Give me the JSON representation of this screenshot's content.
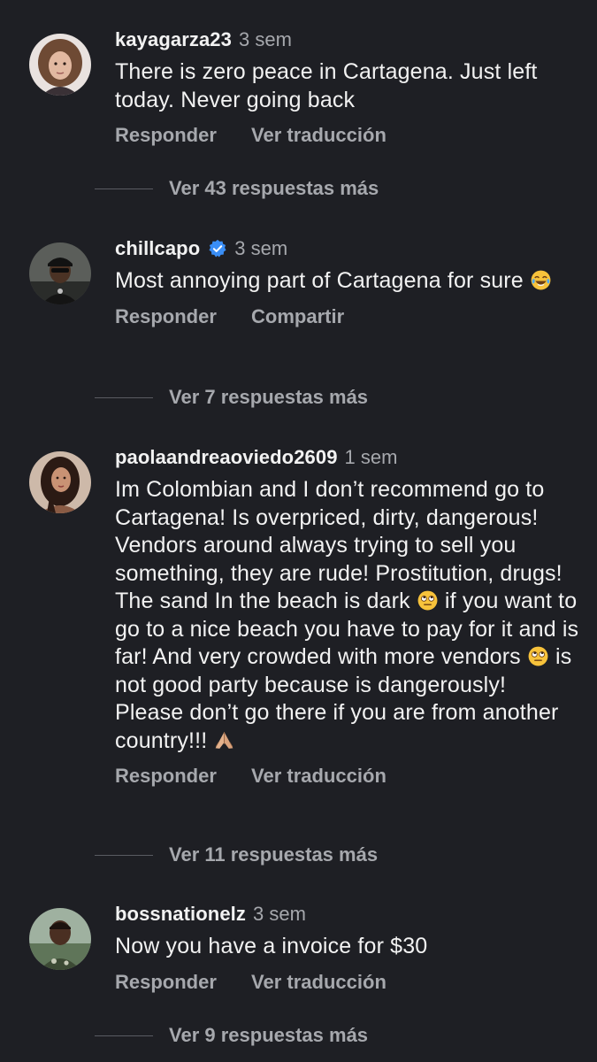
{
  "comments": [
    {
      "username": "kayagarza23",
      "time": "3 sem",
      "text": "There is zero peace in Cartagena.  Just left today.  Never going back",
      "actions": [
        "Responder",
        "Ver traducción"
      ],
      "replies": "Ver 43 respuestas más",
      "avatar": "woman-with-curly-hair"
    },
    {
      "username": "chillcapo",
      "verified": true,
      "time": "3 sem",
      "text": "Most annoying part of Cartagena for sure",
      "emoji": "tears-of-joy-emoji",
      "actions": [
        "Responder",
        "Compartir"
      ],
      "replies": "Ver 7 respuestas más",
      "avatar": "man-with-cap-and-sunglasses"
    },
    {
      "username": "paolaandreaoviedo2609",
      "time": "1 sem",
      "text_parts": [
        "Im Colombian and I don’t recommend go to Cartagena! Is overpriced, dirty, dangerous! Vendors around always trying to sell you something, they are rude! Prostitution, drugs! The sand In the beach is dark ",
        " if you want to go to a nice beach you have to pay for it and is far! And very crowded with more vendors ",
        " is not good party because is dangerously! Please don’t go there if you are from another country!!! "
      ],
      "emojis": [
        "eye-roll-emoji",
        "eye-roll-emoji",
        "folded-hands-emoji"
      ],
      "actions": [
        "Responder",
        "Ver traducción"
      ],
      "replies": "Ver 11 respuestas más",
      "avatar": "woman-with-long-dark-hair"
    },
    {
      "username": "bossnationelz",
      "time": "3 sem",
      "text": "Now you have a invoice for $30",
      "actions": [
        "Responder",
        "Ver traducción"
      ],
      "replies": "Ver 9 respuestas más",
      "avatar": "man-outdoors"
    }
  ],
  "colors": {
    "background": "#1e1f24",
    "primary_text": "#f2f2f2",
    "secondary_text": "#a6a8ad",
    "verified_badge": "#3a8ef6"
  }
}
